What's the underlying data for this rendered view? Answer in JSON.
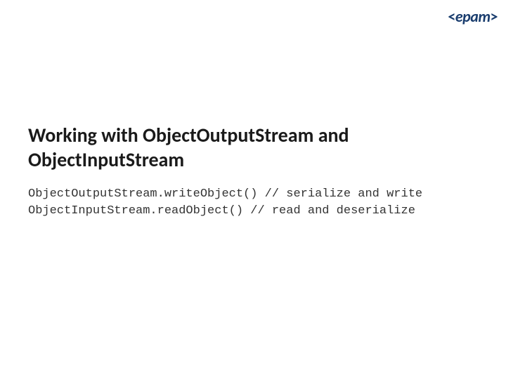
{
  "logo": {
    "text": "<epam>"
  },
  "slide": {
    "title": "Working with ObjectOutputStream and ObjectInputStream",
    "code_line_1": "ObjectOutputStream.writeObject() // serialize and write",
    "code_line_2": "ObjectInputStream.readObject() // read and deserialize"
  }
}
